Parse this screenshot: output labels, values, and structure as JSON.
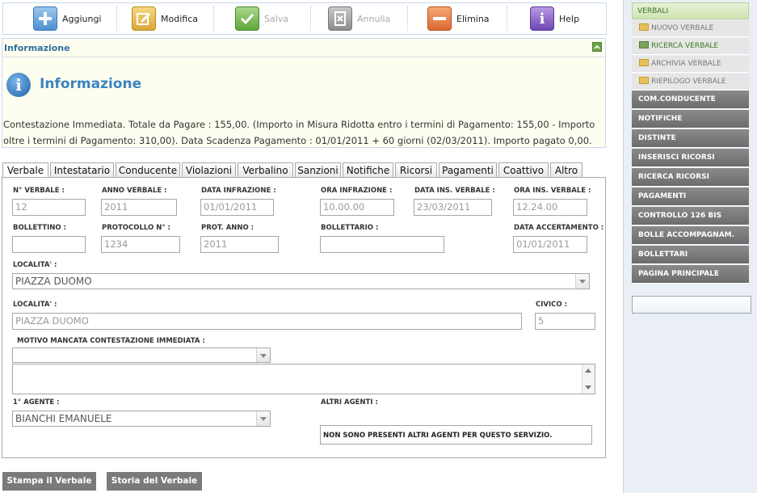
{
  "toolbar": {
    "add": "Aggiungi",
    "edit": "Modifica",
    "save": "Salva",
    "cancel": "Annulla",
    "delete": "Elimina",
    "help": "Help"
  },
  "info": {
    "header": "Informazione",
    "title": "Informazione",
    "text": "Contestazione Immediata. Totale da Pagare : 155,00. (Importo in Misura Ridotta entro i termini di Pagamento: 155,00 - Importo oltre i termini di Pagamento: 310,00). Data Scadenza Pagamento : 01/01/2011 + 60 giorni (02/03/2011). Importo pagato 0,00."
  },
  "tabs": [
    "Verbale",
    "Intestatario",
    "Conducente",
    "Violazioni",
    "Verbalino",
    "Sanzioni",
    "Notifiche",
    "Ricorsi",
    "Pagamenti",
    "Coattivo",
    "Altro"
  ],
  "form": {
    "n_verbale": {
      "label": "N° VERBALE :",
      "value": "12"
    },
    "anno_verbale": {
      "label": "ANNO VERBALE :",
      "value": "2011"
    },
    "data_infrazione": {
      "label": "DATA INFRAZIONE :",
      "value": "01/01/2011"
    },
    "ora_infrazione": {
      "label": "ORA INFRAZIONE :",
      "value": "10.00.00"
    },
    "data_ins_verbale": {
      "label": "DATA INS. VERBALE :",
      "value": "23/03/2011"
    },
    "ora_ins_verbale": {
      "label": "ORA INS. VERBALE :",
      "value": "12.24.00"
    },
    "bollettino": {
      "label": "BOLLETTINO :",
      "value": ""
    },
    "protocollo": {
      "label": "PROTOCOLLO N° :",
      "value": "1234"
    },
    "prot_anno": {
      "label": "PROT. ANNO :",
      "value": "2011"
    },
    "bollettario": {
      "label": "BOLLETTARIO :",
      "value": ""
    },
    "data_accertamento": {
      "label": "DATA ACCERTAMENTO :",
      "value": "01/01/2011"
    },
    "localita_select": {
      "label": "LOCALITA' :",
      "value": "PIAZZA DUOMO"
    },
    "localita_text": {
      "label": "LOCALITA' :",
      "value": "PIAZZA DUOMO"
    },
    "civico": {
      "label": "CIVICO :",
      "value": "5"
    },
    "motivo": {
      "label": "MOTIVO MANCATA CONTESTAZIONE IMMEDIATA :",
      "value": ""
    },
    "primo_agente": {
      "label": "1° AGENTE :",
      "value": "BIANCHI EMANUELE"
    },
    "altri_agenti": {
      "label": "ALTRI AGENTI :",
      "value": "NON SONO PRESENTI ALTRI AGENTI PER QUESTO SERVIZIO."
    }
  },
  "bottom_buttons": {
    "print": "Stampa il Verbale",
    "history": "Storia del Verbale"
  },
  "sidebar": {
    "header": "VERBALI",
    "sub_items": [
      "NUOVO VERBALE",
      "RICERCA VERBALE",
      "ARCHIVIA VERBALE",
      "RIEPILOGO VERBALE"
    ],
    "selected": "RICERCA VERBALE",
    "items": [
      "COM.CONDUCENTE",
      "NOTIFICHE",
      "DISTINTE",
      "INSERISCI RICORSI",
      "RICERCA RICORSI",
      "PAGAMENTI",
      "CONTROLLO 126 BIS",
      "BOLLE ACCOMPAGNAM.",
      "BOLLETTARI",
      "PAGINA PRINCIPALE"
    ]
  }
}
